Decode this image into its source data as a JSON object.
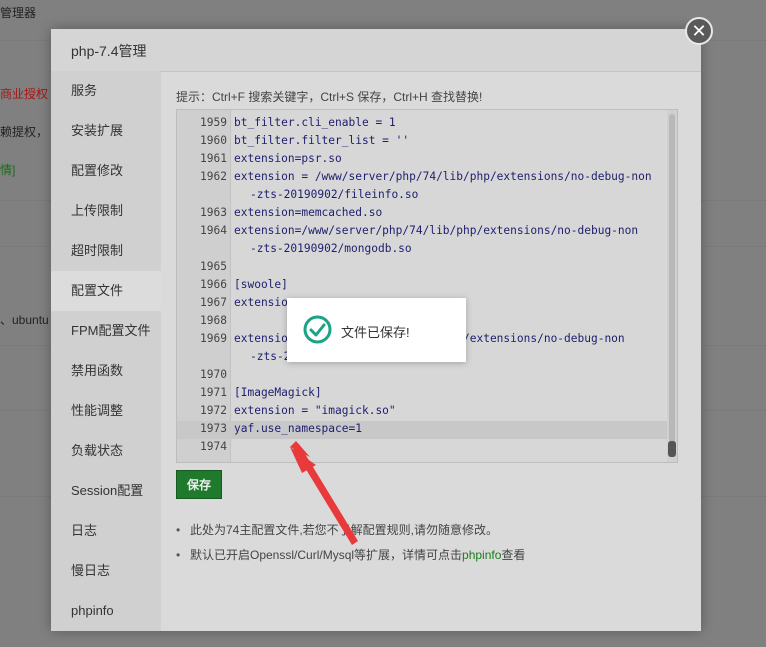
{
  "background": {
    "top_left_text": "管理器",
    "red_text": "商业授权",
    "auth_text": "赖提权，",
    "green_text": "情]",
    "ubuntu_text": "、ubuntu"
  },
  "modal": {
    "title": "php-7.4管理",
    "close_icon": "close-icon"
  },
  "sidebar": {
    "items": [
      {
        "label": "服务"
      },
      {
        "label": "安装扩展"
      },
      {
        "label": "配置修改"
      },
      {
        "label": "上传限制"
      },
      {
        "label": "超时限制"
      },
      {
        "label": "配置文件"
      },
      {
        "label": "FPM配置文件"
      },
      {
        "label": "禁用函数"
      },
      {
        "label": "性能调整"
      },
      {
        "label": "负载状态"
      },
      {
        "label": "Session配置"
      },
      {
        "label": "日志"
      },
      {
        "label": "慢日志"
      },
      {
        "label": "phpinfo"
      }
    ],
    "active_index": 5
  },
  "editor": {
    "tip": "提示：Ctrl+F 搜索关键字，Ctrl+S 保存，Ctrl+H 查找替换!",
    "lines": [
      {
        "num": "1959",
        "text": "bt_filter.cli_enable = 1"
      },
      {
        "num": "1960",
        "text": "bt_filter.filter_list = ''"
      },
      {
        "num": "1961",
        "text": "extension=psr.so"
      },
      {
        "num": "1962",
        "text": "extension = /www/server/php/74/lib/php/extensions/no-debug-non",
        "wrap": "-zts-20190902/fileinfo.so"
      },
      {
        "num": "1963",
        "text": "extension=memcached.so"
      },
      {
        "num": "1964",
        "text": "extension=/www/server/php/74/lib/php/extensions/no-debug-non",
        "wrap": "-zts-20190902/mongodb.so"
      },
      {
        "num": "1965",
        "text": ""
      },
      {
        "num": "1966",
        "text": "[swoole]"
      },
      {
        "num": "1967",
        "text": "extensio"
      },
      {
        "num": "1968",
        "text": ""
      },
      {
        "num": "1969",
        "text": "extensio                      /php/extensions/no-debug-non",
        "wrap": "-zts-2"
      },
      {
        "num": "1970",
        "text": ""
      },
      {
        "num": "1971",
        "text": "[ImageMagick]"
      },
      {
        "num": "1972",
        "text": "extension = \"imagick.so\""
      },
      {
        "num": "1973",
        "text": "yaf.use_namespace=1"
      },
      {
        "num": "1974",
        "text": ""
      }
    ]
  },
  "save_button": "保存",
  "notes": {
    "note1": "此处为74主配置文件,若您不了解配置规则,请勿随意修改。",
    "note2_prefix": "默认已开启Openssl/Curl/Mysql等扩展，详情可点击",
    "note2_link": "phpinfo",
    "note2_suffix": "查看"
  },
  "toast": {
    "message": "文件已保存!",
    "icon": "check-circle-icon",
    "icon_color": "#1aa385"
  },
  "annotation": {
    "arrow_color": "#e83a3a"
  }
}
